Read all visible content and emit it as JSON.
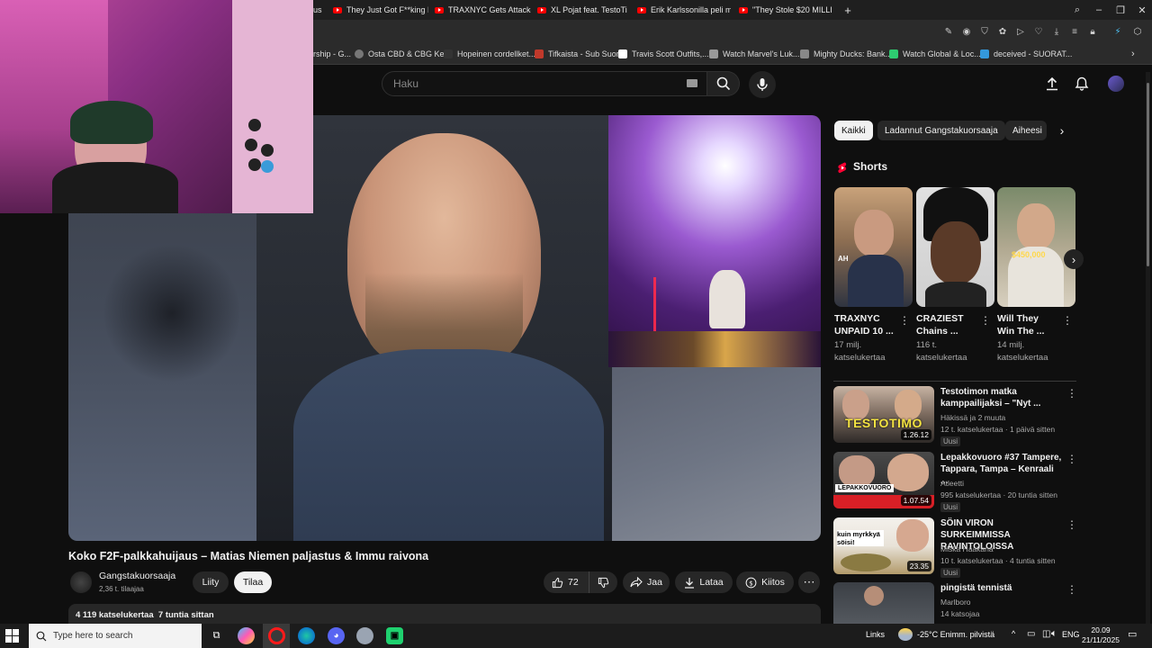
{
  "browser": {
    "tabs": [
      {
        "title": "They Just Got F**king De",
        "icon": "youtube-icon"
      },
      {
        "title": "TRAXNYC Gets Attacked I",
        "icon": "youtube-icon"
      },
      {
        "title": "XL Pojat feat. TestoTimo",
        "icon": "youtube-icon"
      },
      {
        "title": "Erik Karlssonilla peli maitt",
        "icon": "youtube-icon"
      },
      {
        "title": "\"They Stole $20 MILLION!",
        "icon": "youtube-icon"
      }
    ],
    "partial_tab": "us",
    "bookmarks": [
      {
        "label": "rship - G...",
        "color": "#5f6368"
      },
      {
        "label": "Osta CBD & CBG Ke...",
        "color": "#777"
      },
      {
        "label": "Hopeinen cordellket...",
        "color": "#333"
      },
      {
        "label": "Tifkaista - Sub Suora",
        "color": "#c0392b"
      },
      {
        "label": "Travis Scott Outfits,...",
        "color": "#fff"
      },
      {
        "label": "Watch Marvel's Luk...",
        "color": "#999"
      },
      {
        "label": "Mighty Ducks: Bank...",
        "color": "#888"
      },
      {
        "label": "Watch Global & Loc...",
        "color": "#2ecc71"
      },
      {
        "label": "deceived - SUORAT...",
        "color": "#3498db"
      }
    ]
  },
  "youtube": {
    "search_placeholder": "Haku",
    "video_title": "Koko F2F-palkkahuijaus – Matias Niemen paljastus & Immu raivona",
    "channel": {
      "name": "Gangstakuorsaaja",
      "subs": "2,36 t. tilaajaa"
    },
    "join_label": "Liity",
    "subscribe_label": "Tilaa",
    "likes": "72",
    "share_label": "Jaa",
    "download_label": "Lataa",
    "thanks_label": "Kiitos",
    "description_meta": "4 119 katselukertaa  7 tuntia sittan"
  },
  "chips": [
    "Kaikki",
    "Ladannut Gangstakuorsaaja",
    "Aiheesi"
  ],
  "shorts": {
    "heading": "Shorts",
    "items": [
      {
        "title_1": "TRAXNYC",
        "title_2": "UNPAID 10 ...",
        "views_1": "17 milj.",
        "views_2": "katselukertaa",
        "thumb_text": "AH"
      },
      {
        "title_1": "CRAZIEST",
        "title_2": "Chains ...",
        "views_1": "116 t.",
        "views_2": "katselukertaa",
        "thumb_text": ""
      },
      {
        "title_1": "Will They",
        "title_2": "Win The ...",
        "views_1": "14 milj.",
        "views_2": "katselukertaa",
        "thumb_text": "$450,000"
      }
    ]
  },
  "recommendations": [
    {
      "title": "Testotimon matka kamppailijaksi – \"Nyt ...",
      "channel": "Häkissä ja 2 muuta",
      "meta": "12 t. katselukertaa · 1 päivä sitten",
      "badge": "Uusi",
      "duration": "1.26.12",
      "thumb_text": "TESTOTIMO"
    },
    {
      "title": "Lepakkovuoro #37 Tampere, Tappara, Tampa – Kenraali ...",
      "channel": "Atleetti",
      "meta": "995 katselukertaa · 20 tuntia sitten",
      "badge": "Uusi",
      "duration": "1.07.54",
      "thumb_text": "LEPAKKOVUORO"
    },
    {
      "title": "SÖIN VIRON SURKEIMMISSA RAVINTOLOISSA",
      "channel": "Miska Haakana",
      "meta": "10 t. katselukertaa · 4 tuntia sitten",
      "badge": "Uusi",
      "duration": "23.35",
      "thumb_text": "kuin myrkkyä söisi!"
    },
    {
      "title": "pingistä tennistä",
      "channel": "Marlboro",
      "meta": "14 katsojaa",
      "badge": "",
      "duration": "",
      "thumb_text": ""
    }
  ],
  "taskbar": {
    "search_placeholder": "Type here to search",
    "links_label": "Links",
    "weather": "-25°C  Enimm. pilvistä",
    "lang": "ENG",
    "time": "20.09",
    "date": "21/11/2025"
  }
}
